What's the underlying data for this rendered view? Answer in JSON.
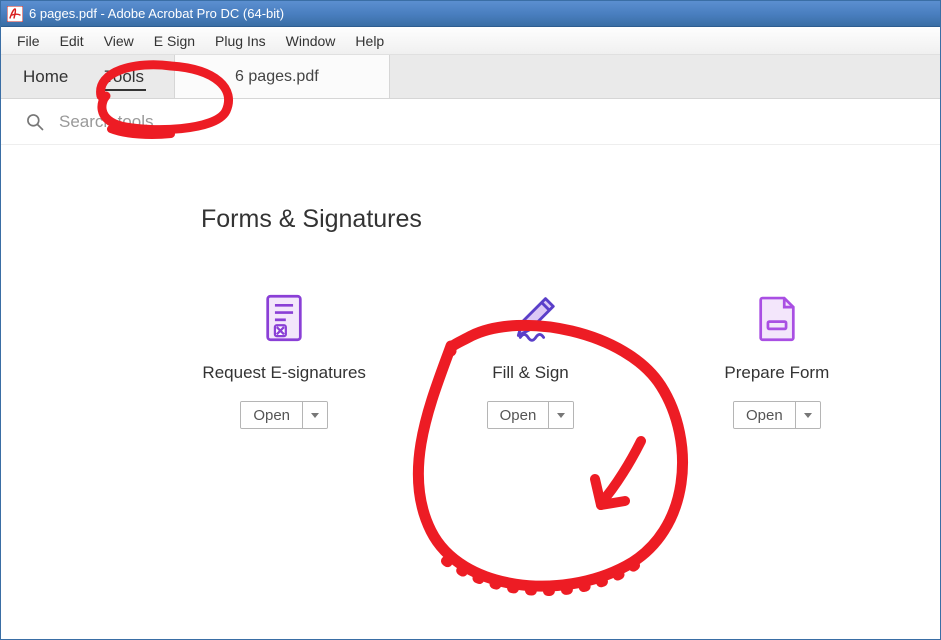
{
  "titlebar": {
    "text": "6 pages.pdf - Adobe Acrobat Pro DC (64-bit)"
  },
  "menubar": {
    "items": [
      "File",
      "Edit",
      "View",
      "E Sign",
      "Plug Ins",
      "Window",
      "Help"
    ]
  },
  "tabs": {
    "home": "Home",
    "tools": "Tools",
    "document": "6 pages.pdf"
  },
  "search": {
    "placeholder": "Search tools"
  },
  "section": {
    "title": "Forms & Signatures"
  },
  "tools": [
    {
      "label": "Request E-signatures",
      "button": "Open",
      "icon": "request-esign"
    },
    {
      "label": "Fill & Sign",
      "button": "Open",
      "icon": "fill-sign"
    },
    {
      "label": "Prepare Form",
      "button": "Open",
      "icon": "prepare-form"
    }
  ],
  "colors": {
    "icon_stroke": "#6a3fc9",
    "icon_fill": "#e7d6f7",
    "annotation": "#ed1c24"
  }
}
